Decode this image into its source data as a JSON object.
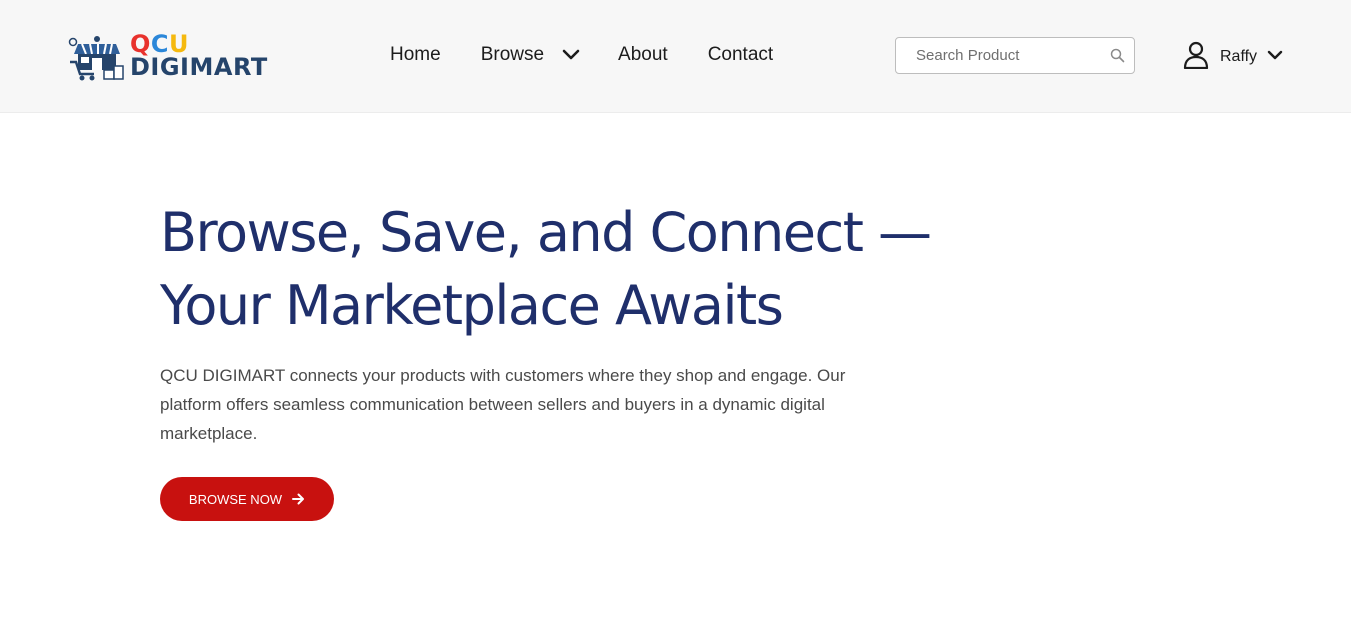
{
  "header": {
    "logo": {
      "line1": [
        "Q",
        "C",
        "U"
      ],
      "line2": "DIGIMART",
      "colors": {
        "q": "#e8322d",
        "c": "#2b87d9",
        "u": "#f5b90f",
        "wordmark": "#25446b"
      }
    },
    "nav": {
      "home": "Home",
      "browse": "Browse",
      "about": "About",
      "contact": "Contact"
    },
    "search": {
      "placeholder": "Search Product",
      "value": "",
      "icon": "search-icon"
    },
    "user": {
      "name": "Raffy",
      "icon": "user-icon"
    }
  },
  "hero": {
    "title_line1": "Browse, Save, and Connect —",
    "title_line2": "Your Marketplace Awaits",
    "description": "QCU DIGIMART connects your products with customers where they shop and engage. Our platform offers seamless communication between sellers and buyers in a dynamic digital marketplace.",
    "cta_label": "BROWSE NOW",
    "cta_icon": "arrow-right-icon"
  },
  "colors": {
    "header_bg": "#f7f7f7",
    "title": "#1f2f6b",
    "cta": "#c8110f",
    "body_text": "#4a4a4a"
  }
}
